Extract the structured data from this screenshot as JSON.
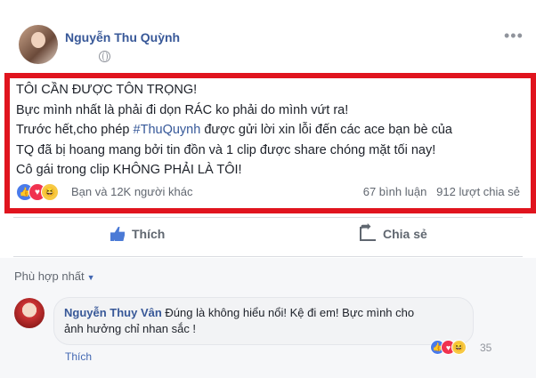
{
  "post": {
    "author": "Nguyễn Thu Quỳnh",
    "lines": [
      "TÔI CẦN ĐƯỢC TÔN TRỌNG!",
      "Bực mình nhất là phải đi dọn RÁC ko phải do mình vứt ra!",
      "Trước hết,cho phép ",
      " được gửi lời xin lỗi đến các ace bạn bè của",
      "TQ đã bị hoang mang bởi tin đồn và 1 clip được share chóng mặt tối nay!",
      "Cô gái trong clip KHÔNG PHẢI LÀ TÔI!"
    ],
    "hashtag": "#ThuQuynh",
    "reactions_text": "Bạn và 12K người khác",
    "comments_count": "67 bình luận",
    "shares_count": "912 lượt chia sẻ",
    "more": "•••"
  },
  "actions": {
    "like": "Thích",
    "share": "Chia sẻ"
  },
  "comments": {
    "sort_label": "Phù hợp nhất",
    "items": [
      {
        "author": "Nguyễn Thuy Vân",
        "text_line1": " Đúng là không hiểu nổi! Kệ đi em! Bực mình cho",
        "text_line2": "ảnh hưởng chỉ nhan sắc !",
        "reaction_count": "35",
        "like_label": "Thích"
      }
    ]
  },
  "colors": {
    "highlight_border": "#e0141e",
    "link": "#385898"
  }
}
